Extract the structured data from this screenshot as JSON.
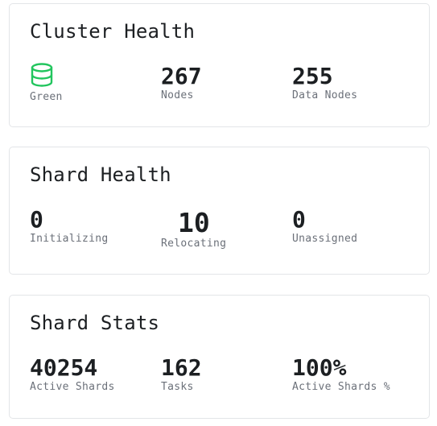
{
  "cluster_health": {
    "title": "Cluster Health",
    "status": {
      "icon": "database-icon",
      "label": "Green",
      "color": "#22c55e"
    },
    "nodes": {
      "value": "267",
      "label": "Nodes"
    },
    "data_nodes": {
      "value": "255",
      "label": "Data Nodes"
    }
  },
  "shard_health": {
    "title": "Shard Health",
    "initializing": {
      "value": "0",
      "label": "Initializing"
    },
    "relocating": {
      "value": "10",
      "label": "Relocating"
    },
    "unassigned": {
      "value": "0",
      "label": "Unassigned"
    }
  },
  "shard_stats": {
    "title": "Shard Stats",
    "active_shards": {
      "value": "40254",
      "label": "Active Shards"
    },
    "tasks": {
      "value": "162",
      "label": "Tasks"
    },
    "active_shards_pct": {
      "value": "100%",
      "label": "Active Shards %"
    }
  }
}
